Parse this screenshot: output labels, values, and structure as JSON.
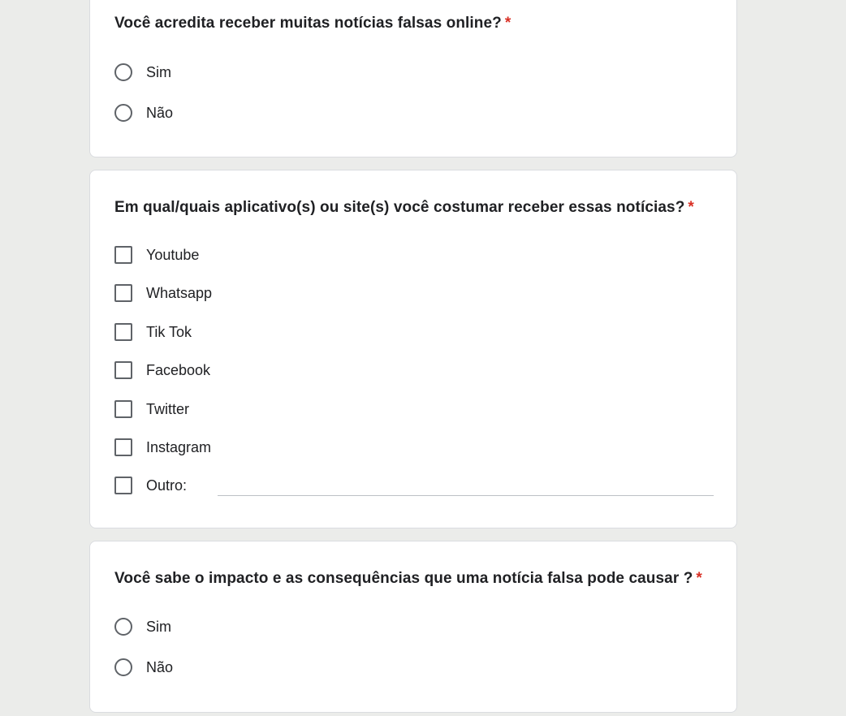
{
  "q1": {
    "title": "Você acredita receber muitas notícias falsas online?",
    "required_mark": "*",
    "options": [
      "Sim",
      "Não"
    ]
  },
  "q2": {
    "title": "Em qual/quais aplicativo(s) ou site(s) você costumar receber essas notícias?",
    "required_mark": "*",
    "options": [
      "Youtube",
      "Whatsapp",
      "Tik Tok",
      "Facebook",
      "Twitter",
      "Instagram"
    ],
    "other_label": "Outro:",
    "other_value": ""
  },
  "q3": {
    "title": "Você sabe o impacto e as consequências que uma notícia falsa pode causar ?",
    "required_mark": "*",
    "options": [
      "Sim",
      "Não"
    ]
  },
  "colors": {
    "background": "#ebecea",
    "card": "#ffffff",
    "required": "#d93025",
    "control_border": "#5f6368"
  }
}
